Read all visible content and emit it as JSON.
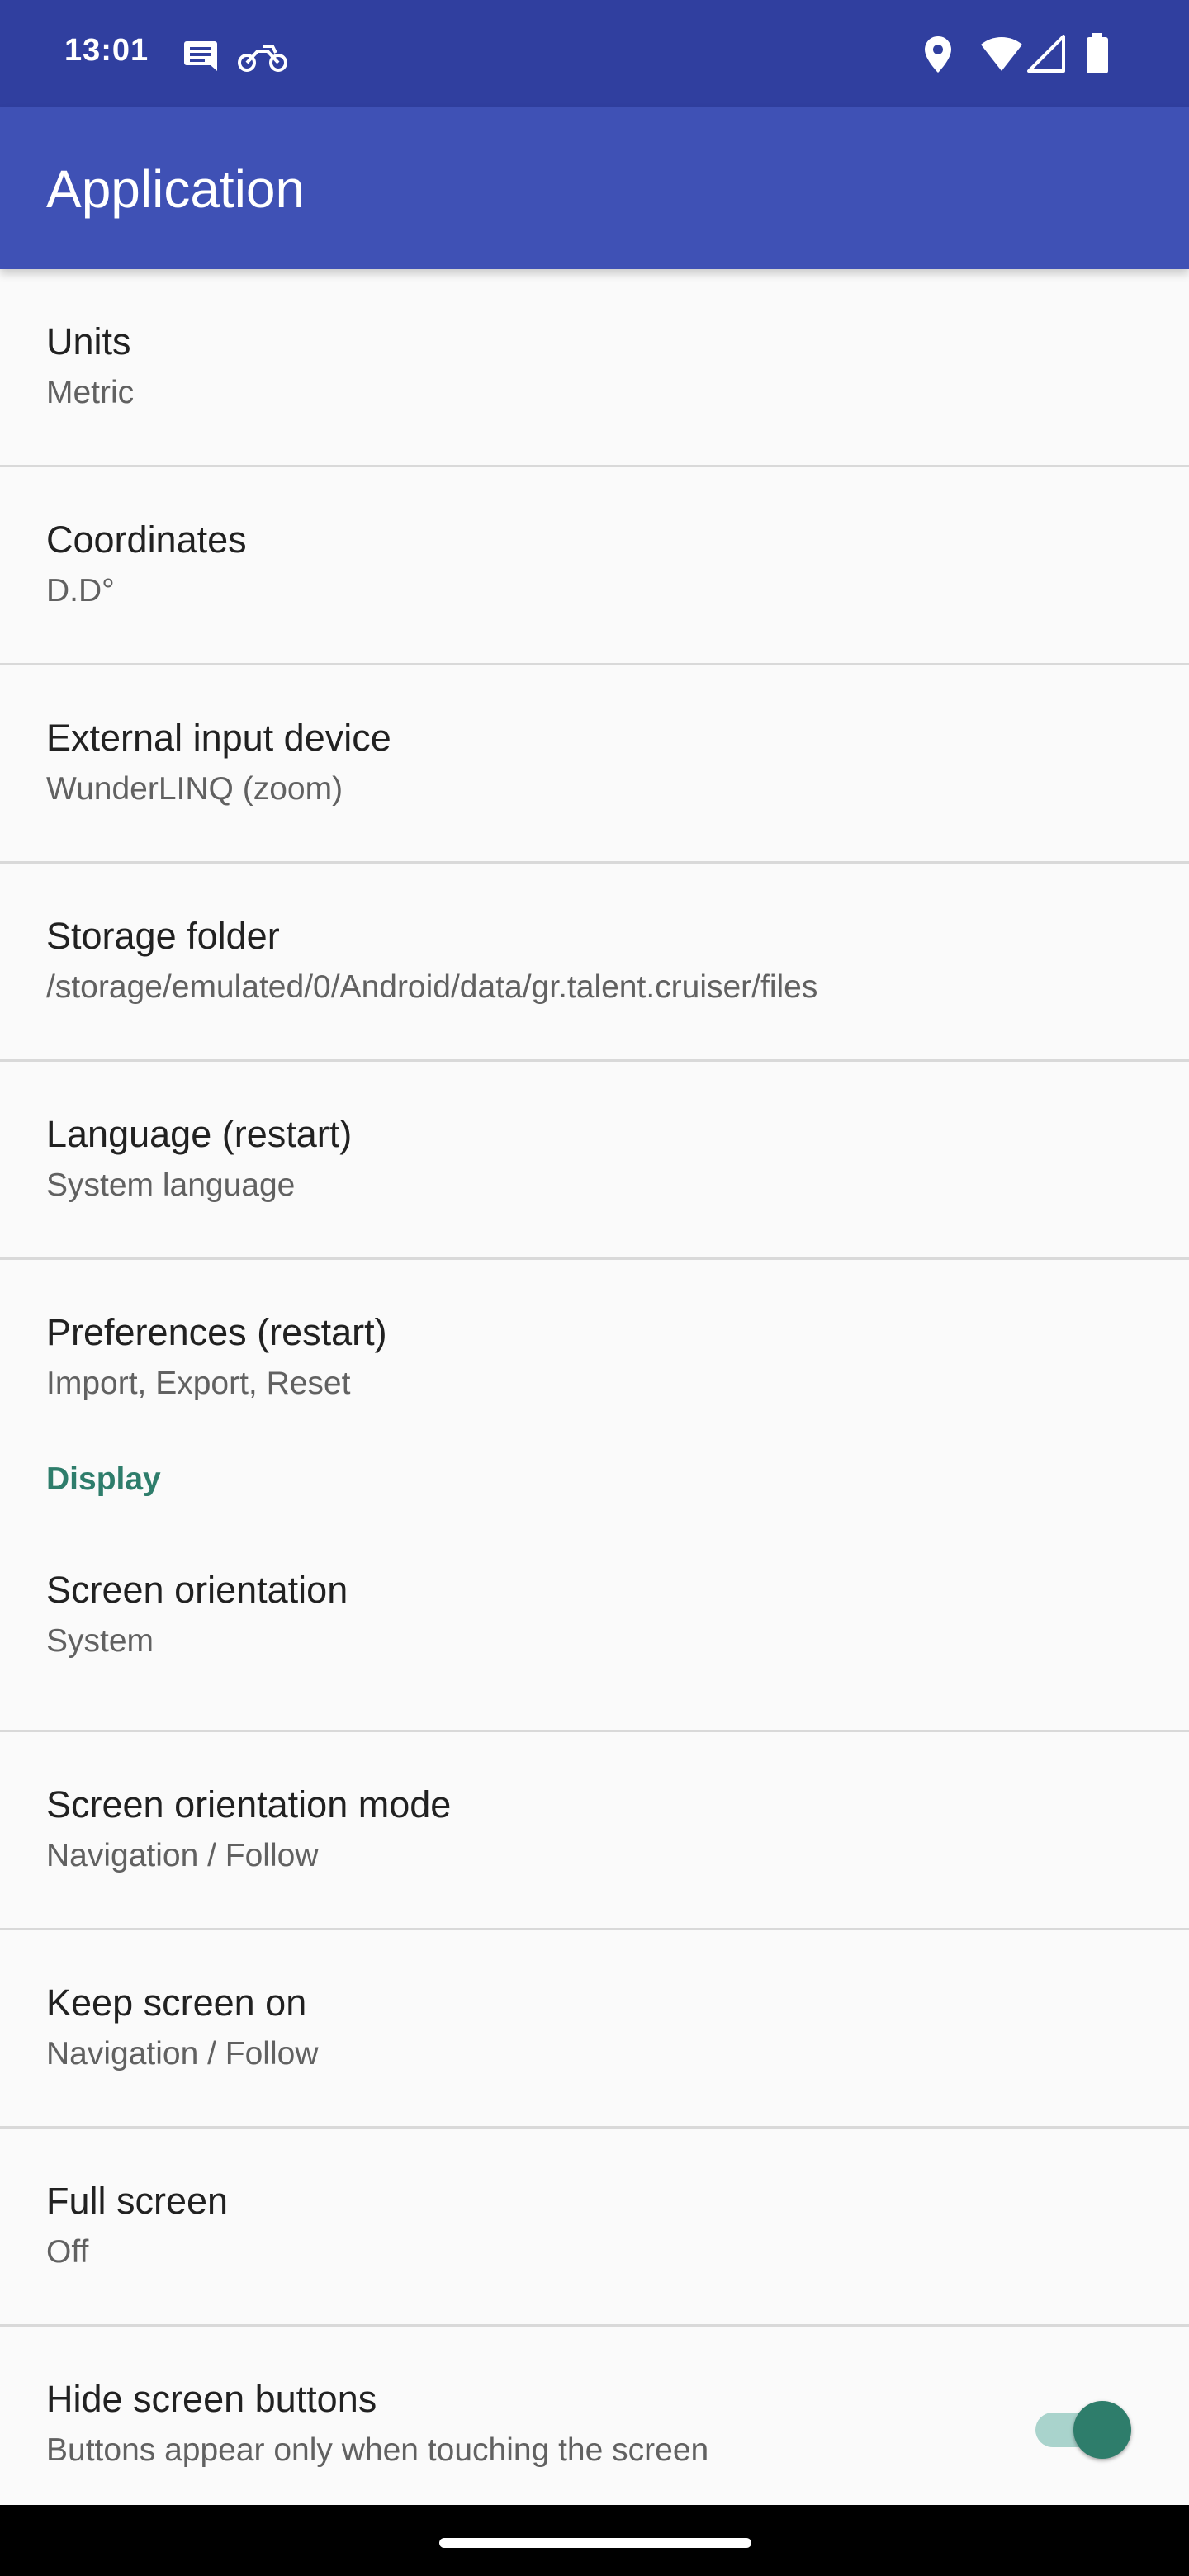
{
  "status_bar": {
    "time": "13:01",
    "left_icons": [
      "message-icon",
      "motorcycle-icon"
    ],
    "right_icons": [
      "location-icon",
      "wifi-icon",
      "signal-icon",
      "battery-icon"
    ]
  },
  "app_bar": {
    "title": "Application"
  },
  "items_top": [
    {
      "title": "Units",
      "summary": "Metric"
    },
    {
      "title": "Coordinates",
      "summary": "D.D°"
    },
    {
      "title": "External input device",
      "summary": "WunderLINQ (zoom)"
    },
    {
      "title": "Storage folder",
      "summary": "/storage/emulated/0/Android/data/gr.talent.cruiser/files"
    },
    {
      "title": "Language (restart)",
      "summary": "System language"
    },
    {
      "title": "Preferences (restart)",
      "summary": "Import, Export, Reset"
    }
  ],
  "display_category": {
    "title": "Display"
  },
  "items_display": [
    {
      "title": "Screen orientation",
      "summary": "System"
    },
    {
      "title": "Screen orientation mode",
      "summary": "Navigation / Follow"
    },
    {
      "title": "Keep screen on",
      "summary": "Navigation / Follow"
    },
    {
      "title": "Full screen",
      "summary": "Off"
    },
    {
      "title": "Hide screen buttons",
      "summary": "Buttons appear only when touching the screen",
      "switch_on": true
    }
  ],
  "colors": {
    "status_bar": "#303f9f",
    "app_bar": "#3f51b5",
    "accent": "#2e7d6b"
  }
}
